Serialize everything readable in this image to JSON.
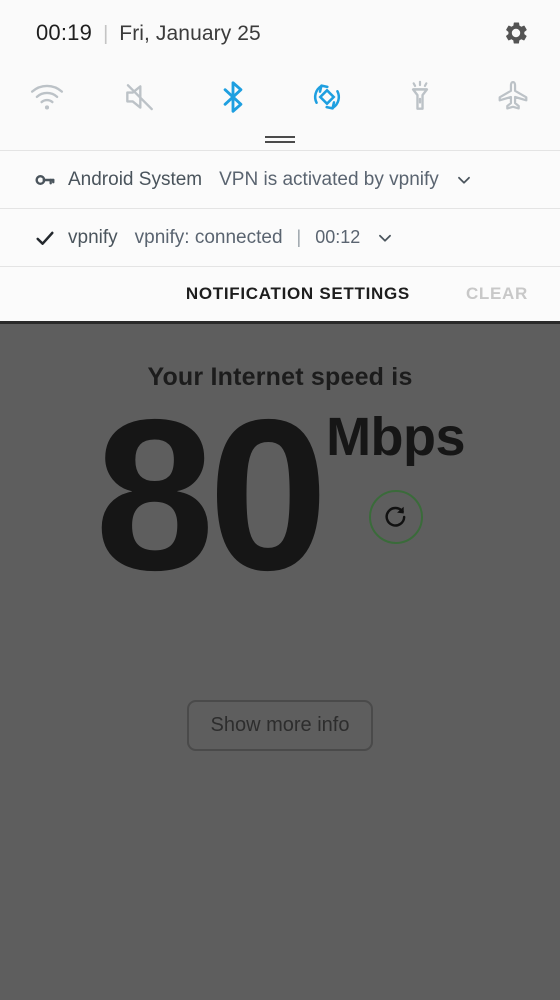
{
  "status_bar": {
    "clock": "00:19",
    "separator": "|",
    "date": "Fri, January 25",
    "settings_icon": "gear-icon"
  },
  "quick_settings": {
    "tiles": [
      {
        "name": "wifi",
        "icon": "wifi-icon",
        "label": "Wi-Fi",
        "active": false,
        "color": "#b9bfc4"
      },
      {
        "name": "sound-mute",
        "icon": "volume-mute-icon",
        "label": "Mute",
        "active": false,
        "color": "#b9bfc4"
      },
      {
        "name": "bluetooth",
        "icon": "bluetooth-icon",
        "label": "Bluetooth",
        "active": true,
        "color": "#1e9fe0"
      },
      {
        "name": "auto-rotate",
        "icon": "auto-rotate-icon",
        "label": "Auto rotate",
        "active": true,
        "color": "#1e9fe0"
      },
      {
        "name": "flashlight",
        "icon": "flashlight-icon",
        "label": "Flashlight",
        "active": false,
        "color": "#b9bfc4"
      },
      {
        "name": "airplane",
        "icon": "airplane-mode-icon",
        "label": "Airplane mode",
        "active": false,
        "color": "#b9bfc4"
      }
    ],
    "drag_handle": "drag-handle"
  },
  "notifications": [
    {
      "icon": "key-icon",
      "app": "Android System",
      "text": "VPN is activated by vpnify",
      "pipe": "",
      "time": "",
      "chevron": "chevron-down-icon"
    },
    {
      "icon": "check-icon",
      "app": "vpnify",
      "text": "vpnify: connected",
      "pipe": "|",
      "time": "00:12",
      "chevron": "chevron-down-icon"
    }
  ],
  "notification_actions": {
    "settings_label": "NOTIFICATION SETTINGS",
    "clear_label": "CLEAR"
  },
  "app": {
    "heading": "Your Internet speed is",
    "speed_value": "80",
    "speed_unit": "Mbps",
    "refresh_icon": "refresh-icon",
    "refresh_ring_color": "#3a6b3a",
    "show_more_label": "Show more info",
    "overlay_color": "#5e5e5e"
  }
}
